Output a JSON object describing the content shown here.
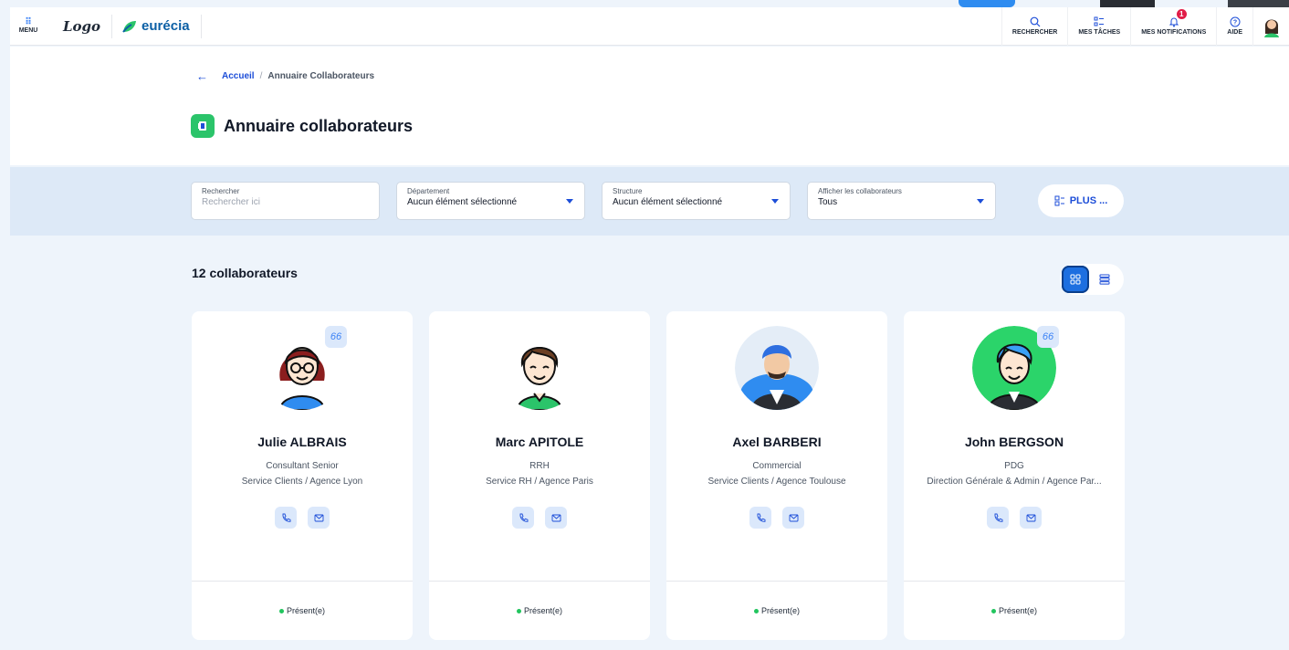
{
  "topbar": {
    "menu_label": "MENU",
    "logo_text": "Logo",
    "brand_name": "eurécia",
    "items": [
      {
        "label": "RECHERCHER",
        "icon": "search-icon"
      },
      {
        "label": "MES TÂCHES",
        "icon": "tasks-icon"
      },
      {
        "label": "MES NOTIFICATIONS",
        "icon": "bell-icon",
        "badge": "1"
      },
      {
        "label": "AIDE",
        "icon": "help-icon"
      }
    ]
  },
  "breadcrumb": {
    "home": "Accueil",
    "separator": "/",
    "current": "Annuaire Collaborateurs"
  },
  "page_title": "Annuaire collaborateurs",
  "filters": {
    "search": {
      "label": "Rechercher",
      "placeholder": "Rechercher ici"
    },
    "department": {
      "label": "Département",
      "value": "Aucun élément sélectionné"
    },
    "structure": {
      "label": "Structure",
      "value": "Aucun élément sélectionné"
    },
    "show": {
      "label": "Afficher les collaborateurs",
      "value": "Tous"
    },
    "more_label": "PLUS ..."
  },
  "count_label": "12 collaborateurs",
  "colors": {
    "accent": "#1d6fe0",
    "brand_green": "#2bc46a",
    "present": "#22c55e"
  },
  "cards": [
    {
      "name": "Julie ALBRAIS",
      "role": "Consultant Senior",
      "dept": "Service Clients / Agence Lyon",
      "status": "Présent(e)",
      "quote": "66"
    },
    {
      "name": "Marc APITOLE",
      "role": "RRH",
      "dept": "Service RH / Agence Paris",
      "status": "Présent(e)"
    },
    {
      "name": "Axel BARBERI",
      "role": "Commercial",
      "dept": "Service Clients / Agence Toulouse",
      "status": "Présent(e)"
    },
    {
      "name": "John BERGSON",
      "role": "PDG",
      "dept": "Direction Générale & Admin / Agence Par...",
      "status": "Présent(e)",
      "quote": "66"
    }
  ]
}
